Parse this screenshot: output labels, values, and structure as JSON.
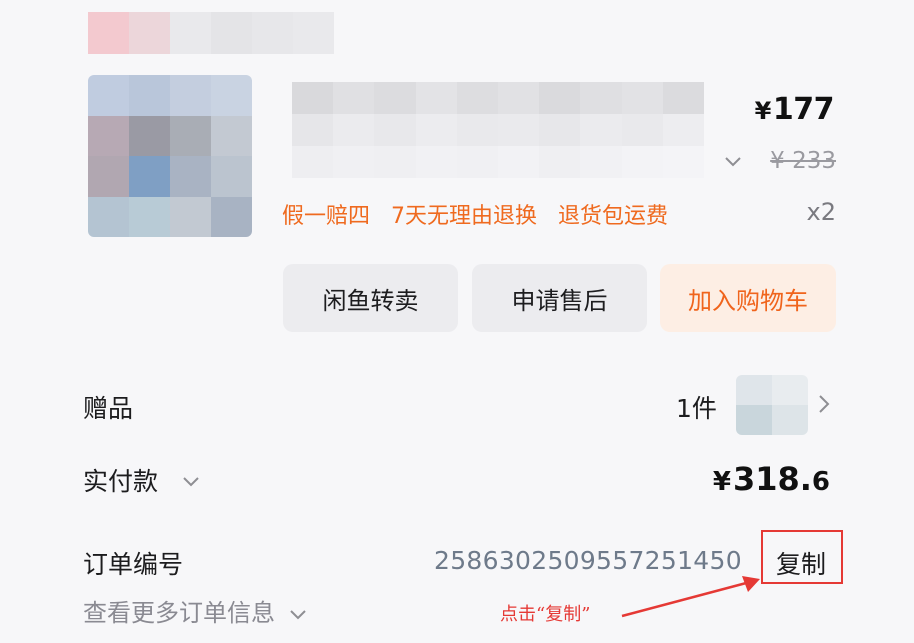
{
  "product": {
    "price_currency": "¥",
    "price": "177",
    "original_price": "¥ 233",
    "quantity": "x2",
    "tags": [
      "假一赔四",
      "7天无理由退换",
      "退货包运费"
    ]
  },
  "actions": {
    "resell": "闲鱼转卖",
    "after_sales": "申请售后",
    "add_to_cart": "加入购物车"
  },
  "gift": {
    "label": "赠品",
    "count": "1件"
  },
  "payment": {
    "label": "实付款",
    "currency": "¥",
    "amount_int": "318.",
    "amount_dec": "6"
  },
  "order": {
    "label": "订单编号",
    "number": "2586302509557251450",
    "copy_label": "复制",
    "more_info": "查看更多订单信息"
  },
  "annotation": {
    "text": "点击“复制”"
  },
  "colors": {
    "accent_orange": "#f0641c",
    "annotation_red": "#e53935"
  }
}
